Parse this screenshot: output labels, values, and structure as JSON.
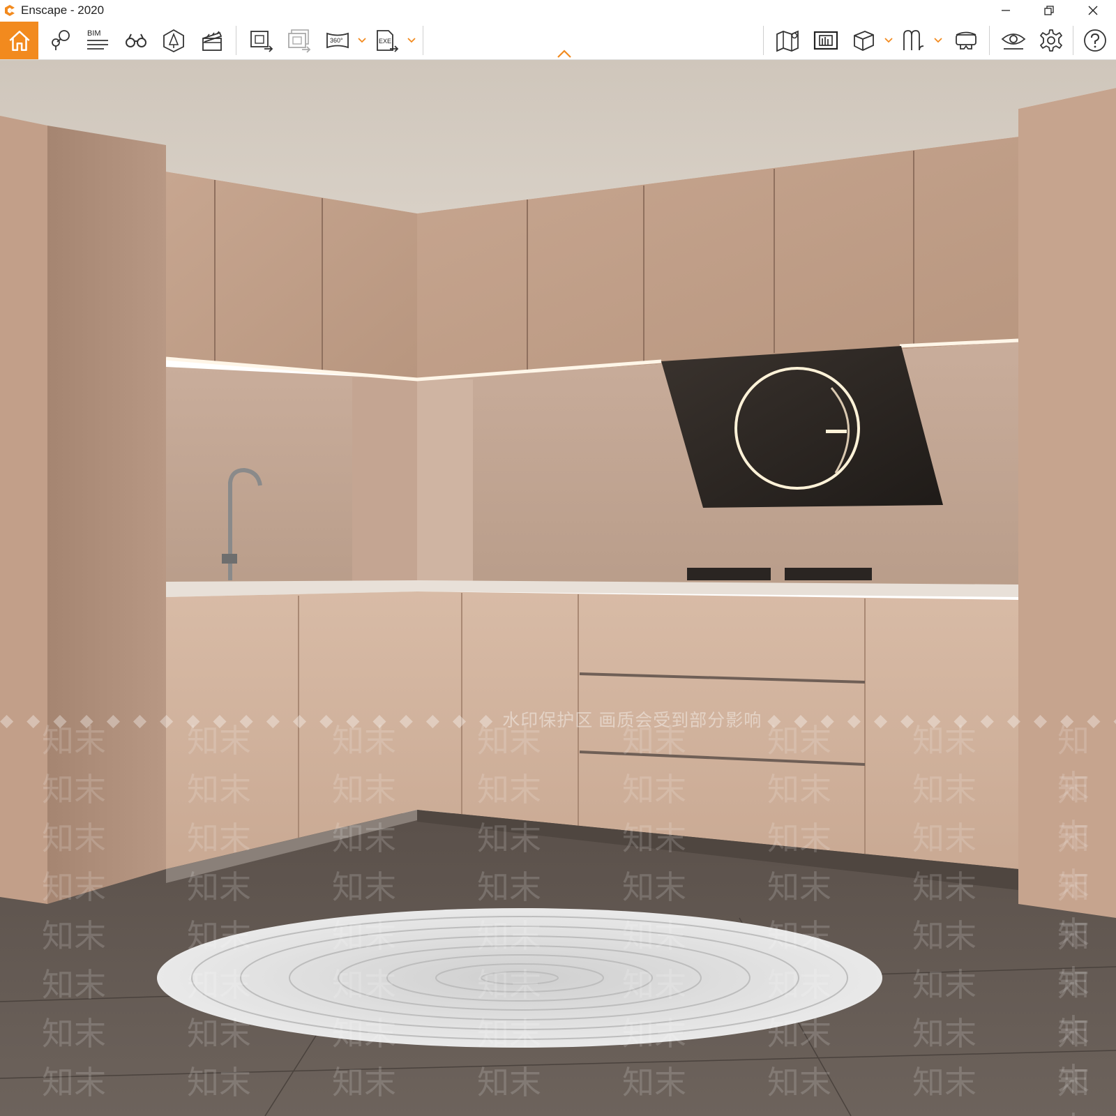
{
  "window": {
    "title": "Enscape - 2020",
    "controls": [
      "minimize",
      "restore",
      "close"
    ]
  },
  "toolbar": {
    "left_tools": [
      {
        "name": "home",
        "icon": "home-icon",
        "active": true
      },
      {
        "name": "views",
        "icon": "location-pins-icon"
      },
      {
        "name": "bim",
        "icon": "bim-icon",
        "label": "BIM"
      },
      {
        "name": "walk",
        "icon": "binoculars-icon"
      },
      {
        "name": "atmosphere",
        "icon": "asset-library-icon"
      },
      {
        "name": "video-editor",
        "icon": "clapperboard-icon"
      },
      {
        "name": "render",
        "icon": "render-export-icon"
      },
      {
        "name": "batch-render",
        "icon": "batch-render-icon"
      },
      {
        "name": "panorama",
        "icon": "panorama-360-icon",
        "label": "360°"
      },
      {
        "name": "exe-export",
        "icon": "exe-export-icon",
        "label": "EXE"
      }
    ],
    "right_tools": [
      {
        "name": "map",
        "icon": "map-icon"
      },
      {
        "name": "views-gallery",
        "icon": "gallery-icon"
      },
      {
        "name": "cube",
        "icon": "cube-icon"
      },
      {
        "name": "collaboration",
        "icon": "annotations-icon"
      },
      {
        "name": "vr",
        "icon": "vr-headset-icon"
      },
      {
        "name": "visibility",
        "icon": "eye-icon"
      },
      {
        "name": "settings",
        "icon": "gear-icon"
      },
      {
        "name": "help",
        "icon": "help-icon"
      }
    ],
    "collapse_icon": "chevron-up-icon",
    "accent_color": "#f28a1e"
  },
  "viewport": {
    "watermark_banner": "水印保护区   画质会受到部分影响",
    "watermark_text": "知末",
    "watermark_small": "知末"
  }
}
